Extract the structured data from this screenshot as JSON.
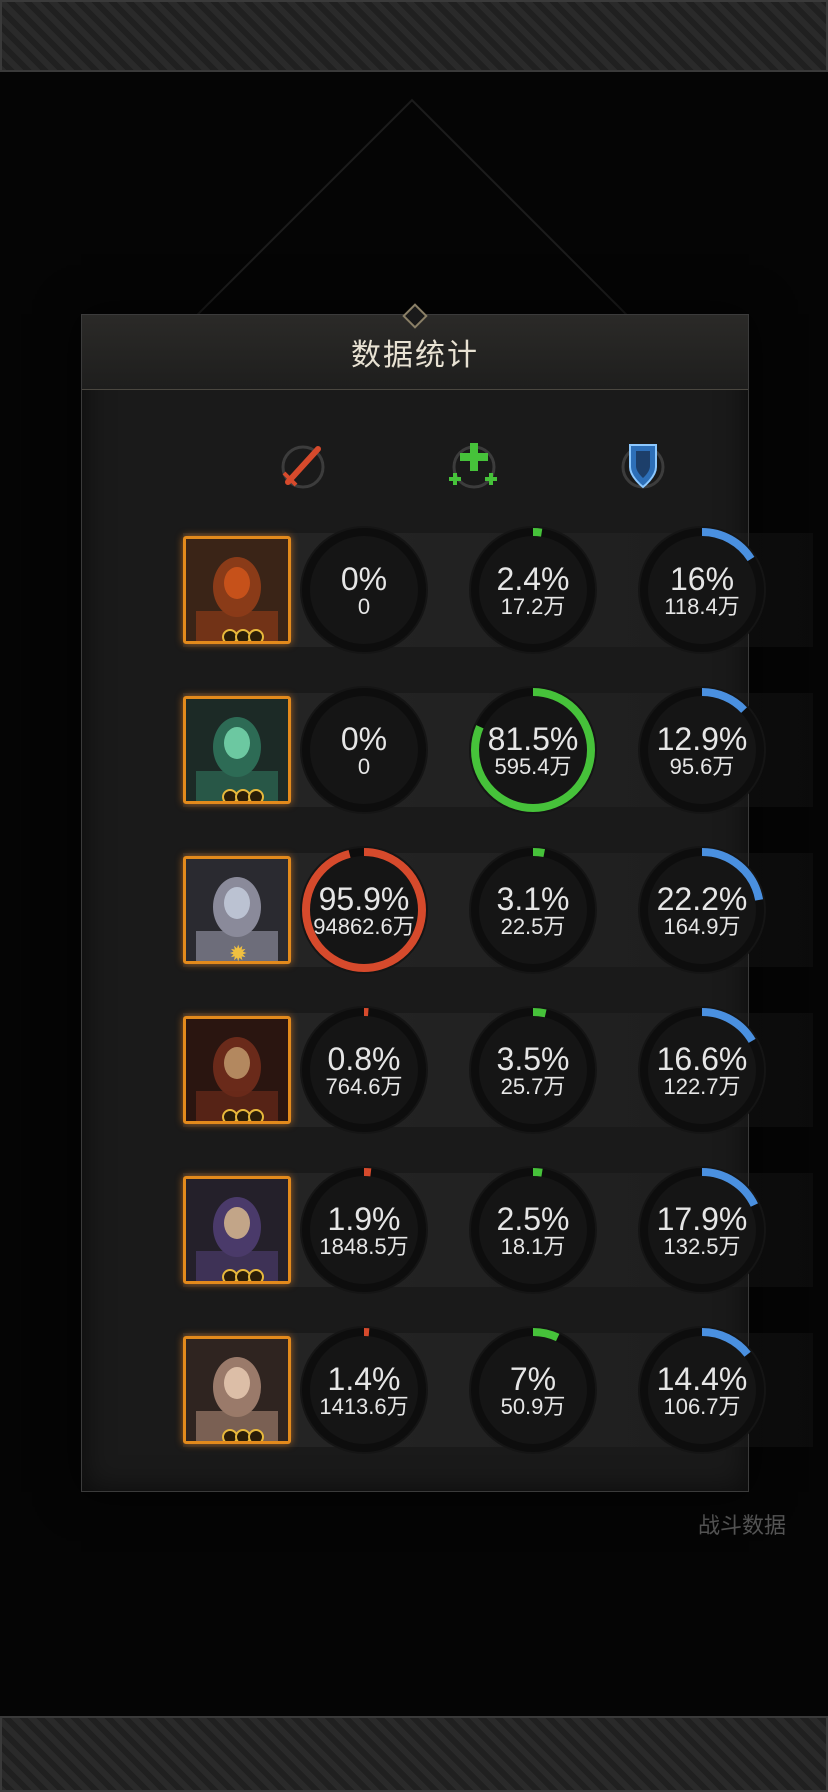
{
  "title": "数据统计",
  "background_label": "战斗数据",
  "columns": [
    {
      "icon": "sword-icon",
      "color": "#d64a2c"
    },
    {
      "icon": "heal-cross-icon",
      "color": "#46c23a"
    },
    {
      "icon": "shield-icon",
      "color": "#4a90e0"
    }
  ],
  "heroes": [
    {
      "portrait": "hero-portrait-1",
      "rank": "3-rings",
      "stats": [
        {
          "pct": 0,
          "pct_label": "0%",
          "value": "0"
        },
        {
          "pct": 2.4,
          "pct_label": "2.4%",
          "value": "17.2万"
        },
        {
          "pct": 16,
          "pct_label": "16%",
          "value": "118.4万"
        }
      ]
    },
    {
      "portrait": "hero-portrait-2",
      "rank": "3-rings",
      "stats": [
        {
          "pct": 0,
          "pct_label": "0%",
          "value": "0"
        },
        {
          "pct": 81.5,
          "pct_label": "81.5%",
          "value": "595.4万"
        },
        {
          "pct": 12.9,
          "pct_label": "12.9%",
          "value": "95.6万"
        }
      ]
    },
    {
      "portrait": "hero-portrait-3",
      "rank": "sun",
      "stats": [
        {
          "pct": 95.9,
          "pct_label": "95.9%",
          "value": "94862.6万"
        },
        {
          "pct": 3.1,
          "pct_label": "3.1%",
          "value": "22.5万"
        },
        {
          "pct": 22.2,
          "pct_label": "22.2%",
          "value": "164.9万"
        }
      ]
    },
    {
      "portrait": "hero-portrait-4",
      "rank": "3-rings",
      "stats": [
        {
          "pct": 0.8,
          "pct_label": "0.8%",
          "value": "764.6万"
        },
        {
          "pct": 3.5,
          "pct_label": "3.5%",
          "value": "25.7万"
        },
        {
          "pct": 16.6,
          "pct_label": "16.6%",
          "value": "122.7万"
        }
      ]
    },
    {
      "portrait": "hero-portrait-5",
      "rank": "3-rings",
      "stats": [
        {
          "pct": 1.9,
          "pct_label": "1.9%",
          "value": "1848.5万"
        },
        {
          "pct": 2.5,
          "pct_label": "2.5%",
          "value": "18.1万"
        },
        {
          "pct": 17.9,
          "pct_label": "17.9%",
          "value": "132.5万"
        }
      ]
    },
    {
      "portrait": "hero-portrait-6",
      "rank": "3-rings",
      "stats": [
        {
          "pct": 1.4,
          "pct_label": "1.4%",
          "value": "1413.6万"
        },
        {
          "pct": 7,
          "pct_label": "7%",
          "value": "50.9万"
        },
        {
          "pct": 14.4,
          "pct_label": "14.4%",
          "value": "106.7万"
        }
      ]
    }
  ]
}
